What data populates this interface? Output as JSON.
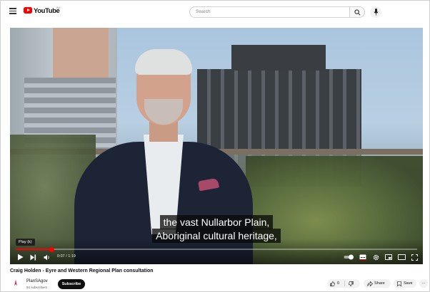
{
  "header": {
    "logo_text": "YouTube",
    "region_code": "AU",
    "search_placeholder": "Search"
  },
  "player": {
    "caption_line1": "the vast Nullarbor Plain,",
    "caption_line2": "Aboriginal cultural heritage,",
    "tooltip": "Play (k)",
    "current_time": "0:07",
    "duration": "1:19",
    "time_display": "0:07 / 1:19",
    "progress_fraction": 0.089
  },
  "video": {
    "title": "Craig Holden - Eyre and Western Regional Plan consultation"
  },
  "channel": {
    "name": "PlanSAgov",
    "subscribers": "94 subscribers",
    "subscribe_label": "Subscribe"
  },
  "actions": {
    "like_count": "0",
    "share_label": "Share",
    "save_label": "Save",
    "more_label": "···"
  },
  "colors": {
    "brand_red": "#ff0000",
    "subscribe_bg": "#0f0f0f"
  },
  "icons": [
    "menu-icon",
    "youtube-logo-icon",
    "search-icon",
    "mic-icon",
    "play-icon",
    "next-icon",
    "volume-icon",
    "autoplay-toggle-icon",
    "subtitles-icon",
    "settings-icon",
    "miniplayer-icon",
    "theater-icon",
    "fullscreen-icon",
    "like-icon",
    "dislike-icon",
    "share-icon",
    "save-icon",
    "more-icon"
  ]
}
